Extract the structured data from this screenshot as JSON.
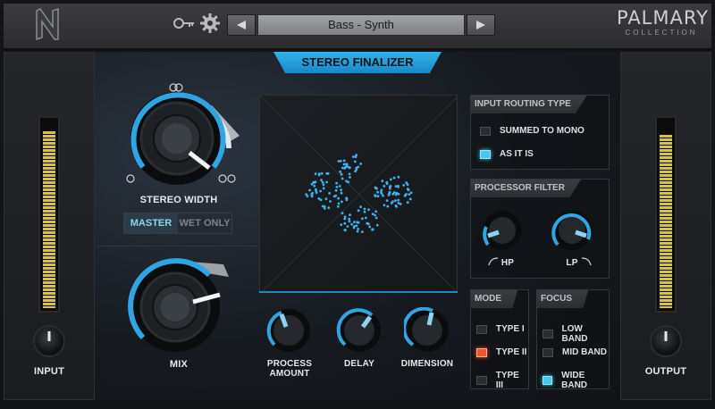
{
  "header": {
    "preset_name": "Bass - Synth",
    "brand_name": "PALMARY",
    "brand_sub": "COLLECTION"
  },
  "module_title": "STEREO FINALIZER",
  "input": {
    "label": "INPUT",
    "meter_level": 0.95
  },
  "output": {
    "label": "OUTPUT",
    "meter_level": 0.93
  },
  "stereo_width": {
    "label": "STEREO WIDTH"
  },
  "mode_toggle": {
    "options": [
      "MASTER",
      "WET ONLY"
    ],
    "selected": "MASTER"
  },
  "mix": {
    "label": "MIX"
  },
  "knobs": {
    "process_amount": "PROCESS AMOUNT",
    "delay": "DELAY",
    "dimension": "DIMENSION"
  },
  "input_routing": {
    "title": "INPUT ROUTING TYPE",
    "options": [
      "SUMMED TO MONO",
      "AS IT IS"
    ],
    "selected": "AS IT IS"
  },
  "processor_filter": {
    "title": "PROCESSOR FILTER",
    "hp": "HP",
    "lp": "LP"
  },
  "mode": {
    "title": "MODE",
    "options": [
      "TYPE I",
      "TYPE II",
      "TYPE III"
    ],
    "selected": "TYPE II"
  },
  "focus": {
    "title": "FOCUS",
    "options": [
      "LOW BAND",
      "MID BAND",
      "WIDE BAND"
    ],
    "selected": "WIDE BAND"
  },
  "colors": {
    "accent": "#2fa6e3",
    "meter": "#d9c33a",
    "led_orange": "#f2552a"
  }
}
